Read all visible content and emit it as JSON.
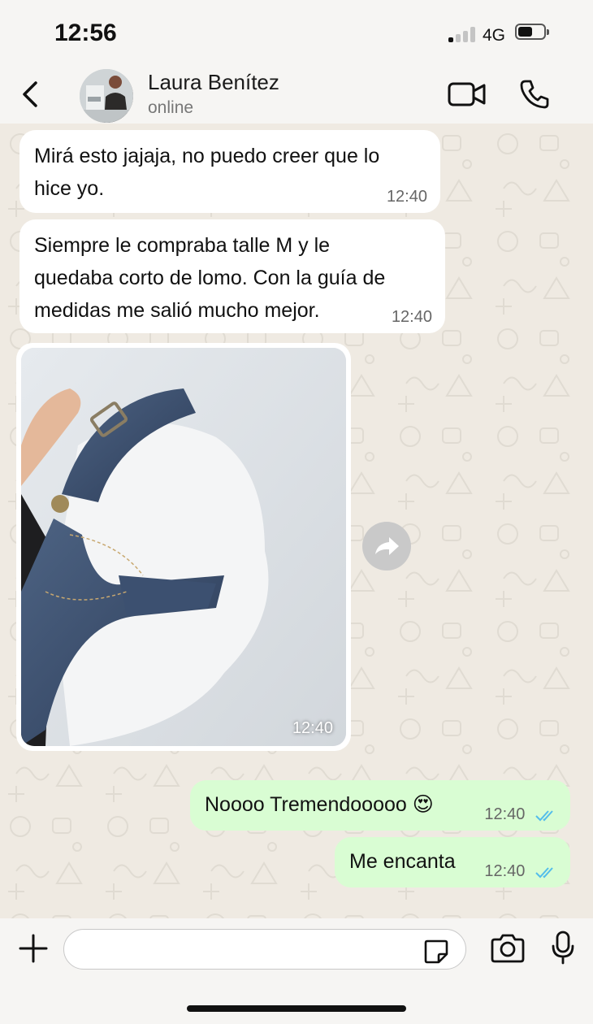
{
  "status_bar": {
    "time": "12:56",
    "network": "4G"
  },
  "header": {
    "contact_name": "Laura Benítez",
    "contact_status": "online",
    "icons": [
      "chevron-left-icon",
      "video-camera-icon",
      "phone-icon"
    ]
  },
  "messages": [
    {
      "direction": "incoming",
      "text": "Mirá esto jajaja, no puedo creer que lo\nhice yo.",
      "time": "12:40"
    },
    {
      "direction": "incoming",
      "text": "Siempre le compraba talle M y le\nquedaba corto de lomo. Con la guía de\nmedidas me salió mucho mejor.",
      "time": "12:40"
    },
    {
      "direction": "incoming",
      "type": "image",
      "time": "12:40"
    },
    {
      "direction": "outgoing",
      "text": "Noooo Tremendooooo 😍",
      "time": "12:40",
      "read": true
    },
    {
      "direction": "outgoing",
      "text": "Me encanta",
      "time": "12:40",
      "read": true
    }
  ],
  "input_bar": {
    "icons": [
      "plus-icon",
      "sticker-icon",
      "camera-icon",
      "microphone-icon"
    ]
  },
  "colors": {
    "incoming_bubble": "#ffffff",
    "outgoing_bubble": "#d9fdd3",
    "chat_background": "#efeae2",
    "read_ticks": "#53bdeb"
  }
}
